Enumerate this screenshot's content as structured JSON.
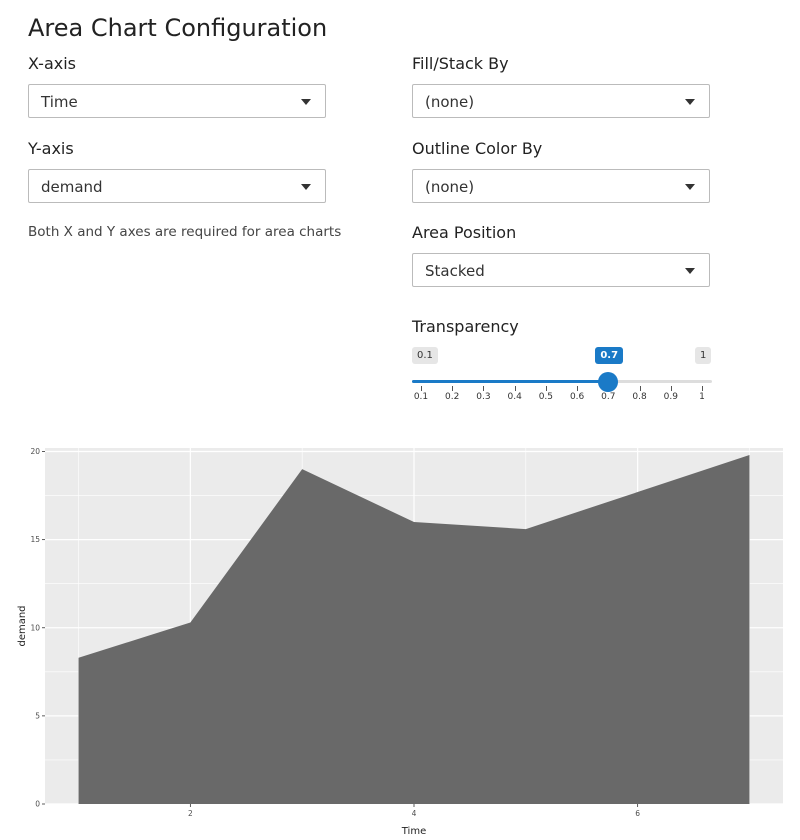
{
  "page": {
    "title": "Area Chart Configuration"
  },
  "x_axis": {
    "label": "X-axis",
    "value": "Time"
  },
  "y_axis": {
    "label": "Y-axis",
    "value": "demand"
  },
  "help_text": "Both X and Y axes are required for area charts",
  "fill_by": {
    "label": "Fill/Stack By",
    "value": "(none)"
  },
  "outline_by": {
    "label": "Outline Color By",
    "value": "(none)"
  },
  "position": {
    "label": "Area Position",
    "value": "Stacked"
  },
  "transparency": {
    "label": "Transparency",
    "min": 0.1,
    "max": 1,
    "value": 0.7,
    "min_label": "0.1",
    "max_label": "1",
    "value_label": "0.7",
    "ticks": [
      "0.1",
      "0.2",
      "0.3",
      "0.4",
      "0.5",
      "0.6",
      "0.7",
      "0.8",
      "0.9",
      "1"
    ],
    "accent": "#1a7ac7"
  },
  "chart_data": {
    "type": "area",
    "x": [
      1,
      2,
      3,
      4,
      5,
      6,
      7
    ],
    "values": [
      8.3,
      10.3,
      19.0,
      16.0,
      15.6,
      17.7,
      19.8
    ],
    "xlabel": "Time",
    "ylabel": "demand",
    "xlim": [
      0.7,
      7.3
    ],
    "ylim": [
      0,
      20.2
    ],
    "x_ticks": [
      2,
      4,
      6
    ],
    "y_ticks": [
      0,
      5,
      10,
      15,
      20
    ],
    "grid": true,
    "fill_color": "#696969",
    "panel_color": "#ebebeb"
  }
}
